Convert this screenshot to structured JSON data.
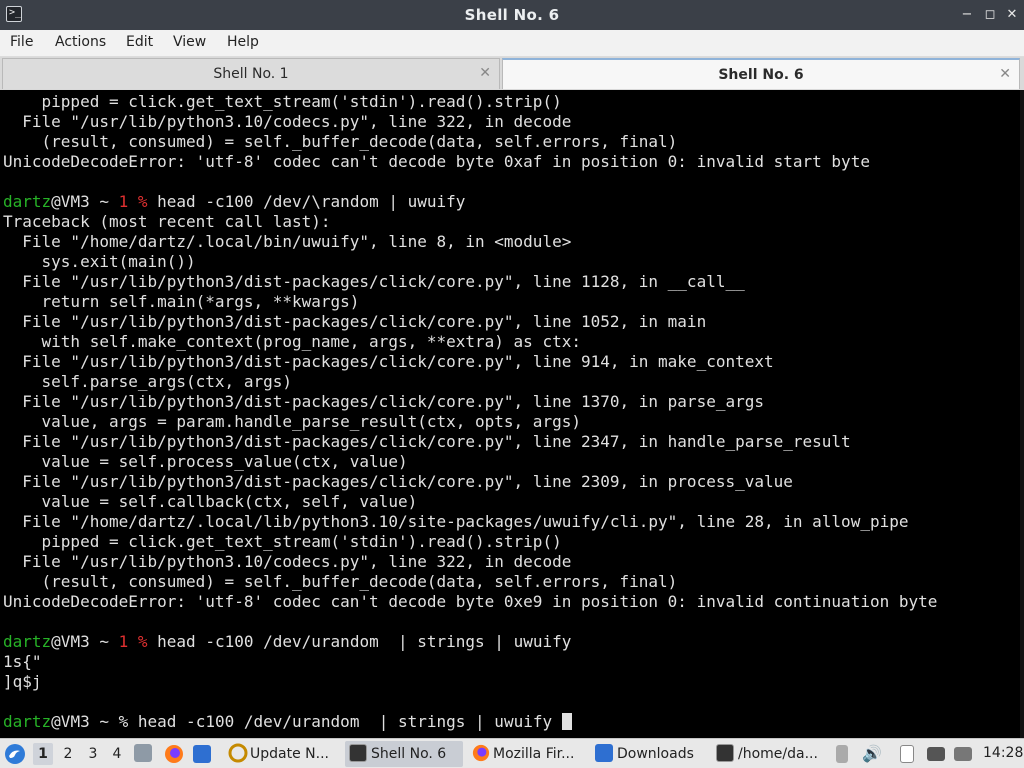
{
  "window": {
    "title": "Shell No. 6",
    "app_icon_glyph": ">_",
    "minimize_glyph": "−",
    "maximize_glyph": "◻",
    "close_glyph": "✕"
  },
  "menubar": {
    "items": [
      "File",
      "Actions",
      "Edit",
      "View",
      "Help"
    ]
  },
  "tabs": [
    {
      "label": "Shell No. 1",
      "close": "✕"
    },
    {
      "label": "Shell No. 6",
      "close": "✕"
    }
  ],
  "terminal": {
    "prompt": {
      "user": "dartz",
      "host_path": "@VM3 ~ ",
      "err_code": "1 %",
      "plain_sign": "%"
    },
    "lines": [
      "    pipped = click.get_text_stream('stdin').read().strip()",
      "  File \"/usr/lib/python3.10/codecs.py\", line 322, in decode",
      "    (result, consumed) = self._buffer_decode(data, self.errors, final)",
      "UnicodeDecodeError: 'utf-8' codec can't decode byte 0xaf in position 0: invalid start byte",
      "",
      "head -c100 /dev/\\random | uwuify",
      "Traceback (most recent call last):",
      "  File \"/home/dartz/.local/bin/uwuify\", line 8, in <module>",
      "    sys.exit(main())",
      "  File \"/usr/lib/python3/dist-packages/click/core.py\", line 1128, in __call__",
      "    return self.main(*args, **kwargs)",
      "  File \"/usr/lib/python3/dist-packages/click/core.py\", line 1052, in main",
      "    with self.make_context(prog_name, args, **extra) as ctx:",
      "  File \"/usr/lib/python3/dist-packages/click/core.py\", line 914, in make_context",
      "    self.parse_args(ctx, args)",
      "  File \"/usr/lib/python3/dist-packages/click/core.py\", line 1370, in parse_args",
      "    value, args = param.handle_parse_result(ctx, opts, args)",
      "  File \"/usr/lib/python3/dist-packages/click/core.py\", line 2347, in handle_parse_result",
      "    value = self.process_value(ctx, value)",
      "  File \"/usr/lib/python3/dist-packages/click/core.py\", line 2309, in process_value",
      "    value = self.callback(ctx, self, value)",
      "  File \"/home/dartz/.local/lib/python3.10/site-packages/uwuify/cli.py\", line 28, in allow_pipe",
      "    pipped = click.get_text_stream('stdin').read().strip()",
      "  File \"/usr/lib/python3.10/codecs.py\", line 322, in decode",
      "    (result, consumed) = self._buffer_decode(data, self.errors, final)",
      "UnicodeDecodeError: 'utf-8' codec can't decode byte 0xe9 in position 0: invalid continuation byte",
      "",
      "head -c100 /dev/urandom  | strings | uwuify",
      "1s{\"",
      "]q$j",
      "",
      "head -c100 /dev/urandom  | strings | uwuify "
    ]
  },
  "taskbar": {
    "workspaces": [
      "1",
      "2",
      "3",
      "4"
    ],
    "tasks": [
      {
        "label": "Update N...",
        "icon": "update-icon"
      },
      {
        "label": "Shell No. 6",
        "icon": "terminal-icon"
      },
      {
        "label": "Mozilla Fir...",
        "icon": "firefox-icon"
      },
      {
        "label": "Downloads",
        "icon": "folder-icon"
      },
      {
        "label": "/home/da...",
        "icon": "terminal-icon"
      }
    ],
    "clock": "14:28"
  }
}
